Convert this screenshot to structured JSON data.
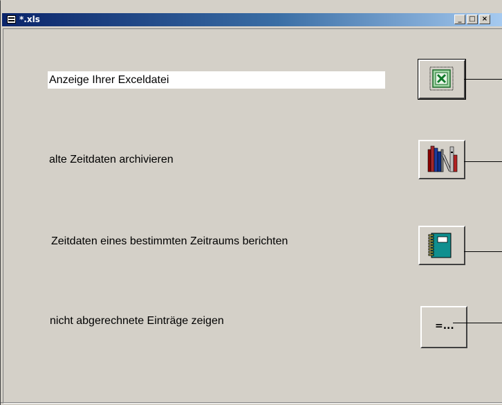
{
  "window": {
    "title": "*.xls",
    "minimize": "_",
    "maximize": "□",
    "close": "×"
  },
  "rows": [
    {
      "label": "Anzeige Ihrer Exceldatei",
      "icon": "excel-icon"
    },
    {
      "label": "alte Zeitdaten archivieren",
      "icon": "library-books-icon"
    },
    {
      "label": "Zeitdaten eines bestimmten Zeitraums berichten",
      "icon": "notebook-icon"
    },
    {
      "label": "nicht abgerechnete Einträge zeigen",
      "icon": "equals-ellipsis-icon",
      "icon_text": "=..."
    }
  ]
}
